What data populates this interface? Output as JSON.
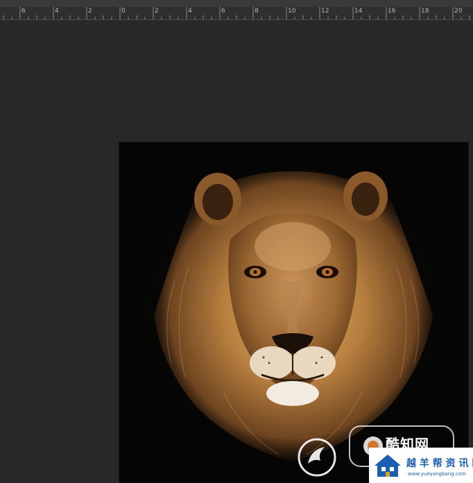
{
  "ruler": {
    "labels": [
      {
        "text": "6"
      },
      {
        "text": "4"
      },
      {
        "text": "2"
      },
      {
        "text": "0"
      },
      {
        "text": "2"
      },
      {
        "text": "4"
      },
      {
        "text": "6"
      },
      {
        "text": "8"
      },
      {
        "text": "10"
      },
      {
        "text": "12"
      },
      {
        "text": "14"
      },
      {
        "text": "16"
      },
      {
        "text": "18"
      },
      {
        "text": "20"
      }
    ]
  },
  "document": {
    "content": "lion-portrait-image"
  },
  "watermarks": {
    "mid_text": "酷知网",
    "br_title": "越 羊 帮 资 讯 网",
    "br_url": "www.yueyangbang.com"
  },
  "colors": {
    "canvas_bg": "#282828",
    "ruler_bg": "#2f2f2f",
    "document_bg": "#050505",
    "lion_mane": "#b07a3c",
    "watermark_blue": "#1a5fb4"
  }
}
